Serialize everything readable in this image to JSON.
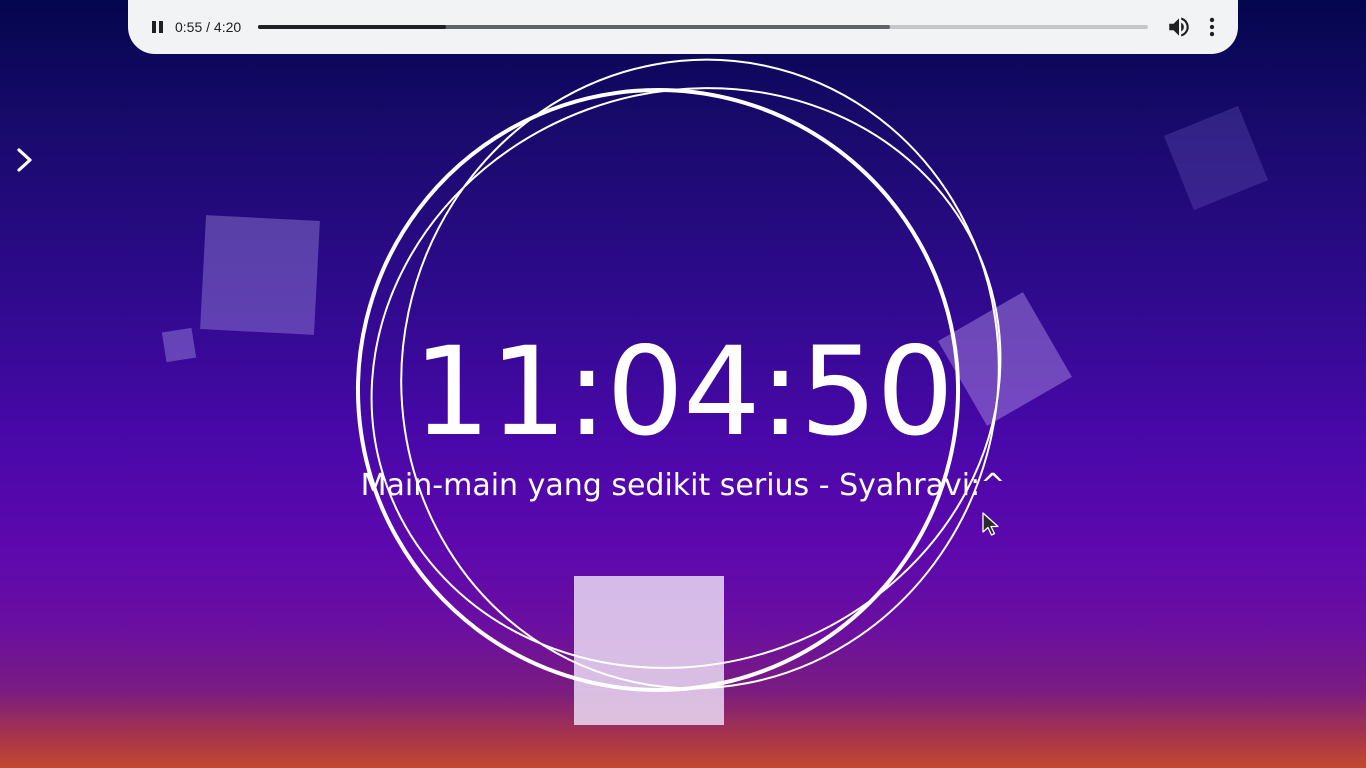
{
  "player": {
    "state_icon": "pause-icon",
    "time_display": "0:55 / 4:20",
    "progress_fraction": 0.2115,
    "buffered_fraction": 0.7101,
    "volume_icon": "volume-icon",
    "more_icon": "more-vertical-icon"
  },
  "nav": {
    "toggle_icon": "chevron-right-icon"
  },
  "clock": {
    "time": "11:04:50",
    "subtitle": "Main-main yang sedikit serius - Syahravi:^"
  },
  "colors": {
    "player_bg": "#f1f3f4",
    "text": "#ffffff",
    "bg_top": "#04064e",
    "bg_mid": "#4a08aa",
    "bg_bottom": "#c24a2e"
  }
}
